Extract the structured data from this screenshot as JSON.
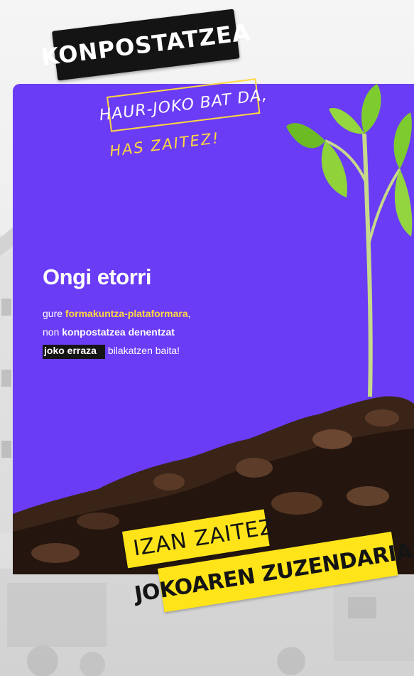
{
  "header": {
    "title": "KONPOSTATZEA",
    "subtitle_line1": "HAUR-JOKO BAT DA,",
    "subtitle_line2": "HAS ZAITEZ!"
  },
  "welcome": {
    "heading": "Ongi etorri",
    "line1_prefix": "gure ",
    "line1_highlight": "formakuntza-plataformara",
    "line1_suffix": ",",
    "line2_prefix": "non ",
    "line2_highlight": "konpostatzea denentzat",
    "line3_highlight": "joko erraza",
    "line3_suffix": " bilakatzen baita!"
  },
  "cta": {
    "line1": "IZAN ZAITEZ",
    "line2": "JOKOAREN ZUZENDARIA!"
  },
  "colors": {
    "card_purple": "#6a3cf6",
    "accent_yellow": "#ffd740",
    "sticker_yellow": "#ffe41a",
    "dark": "#141414"
  }
}
